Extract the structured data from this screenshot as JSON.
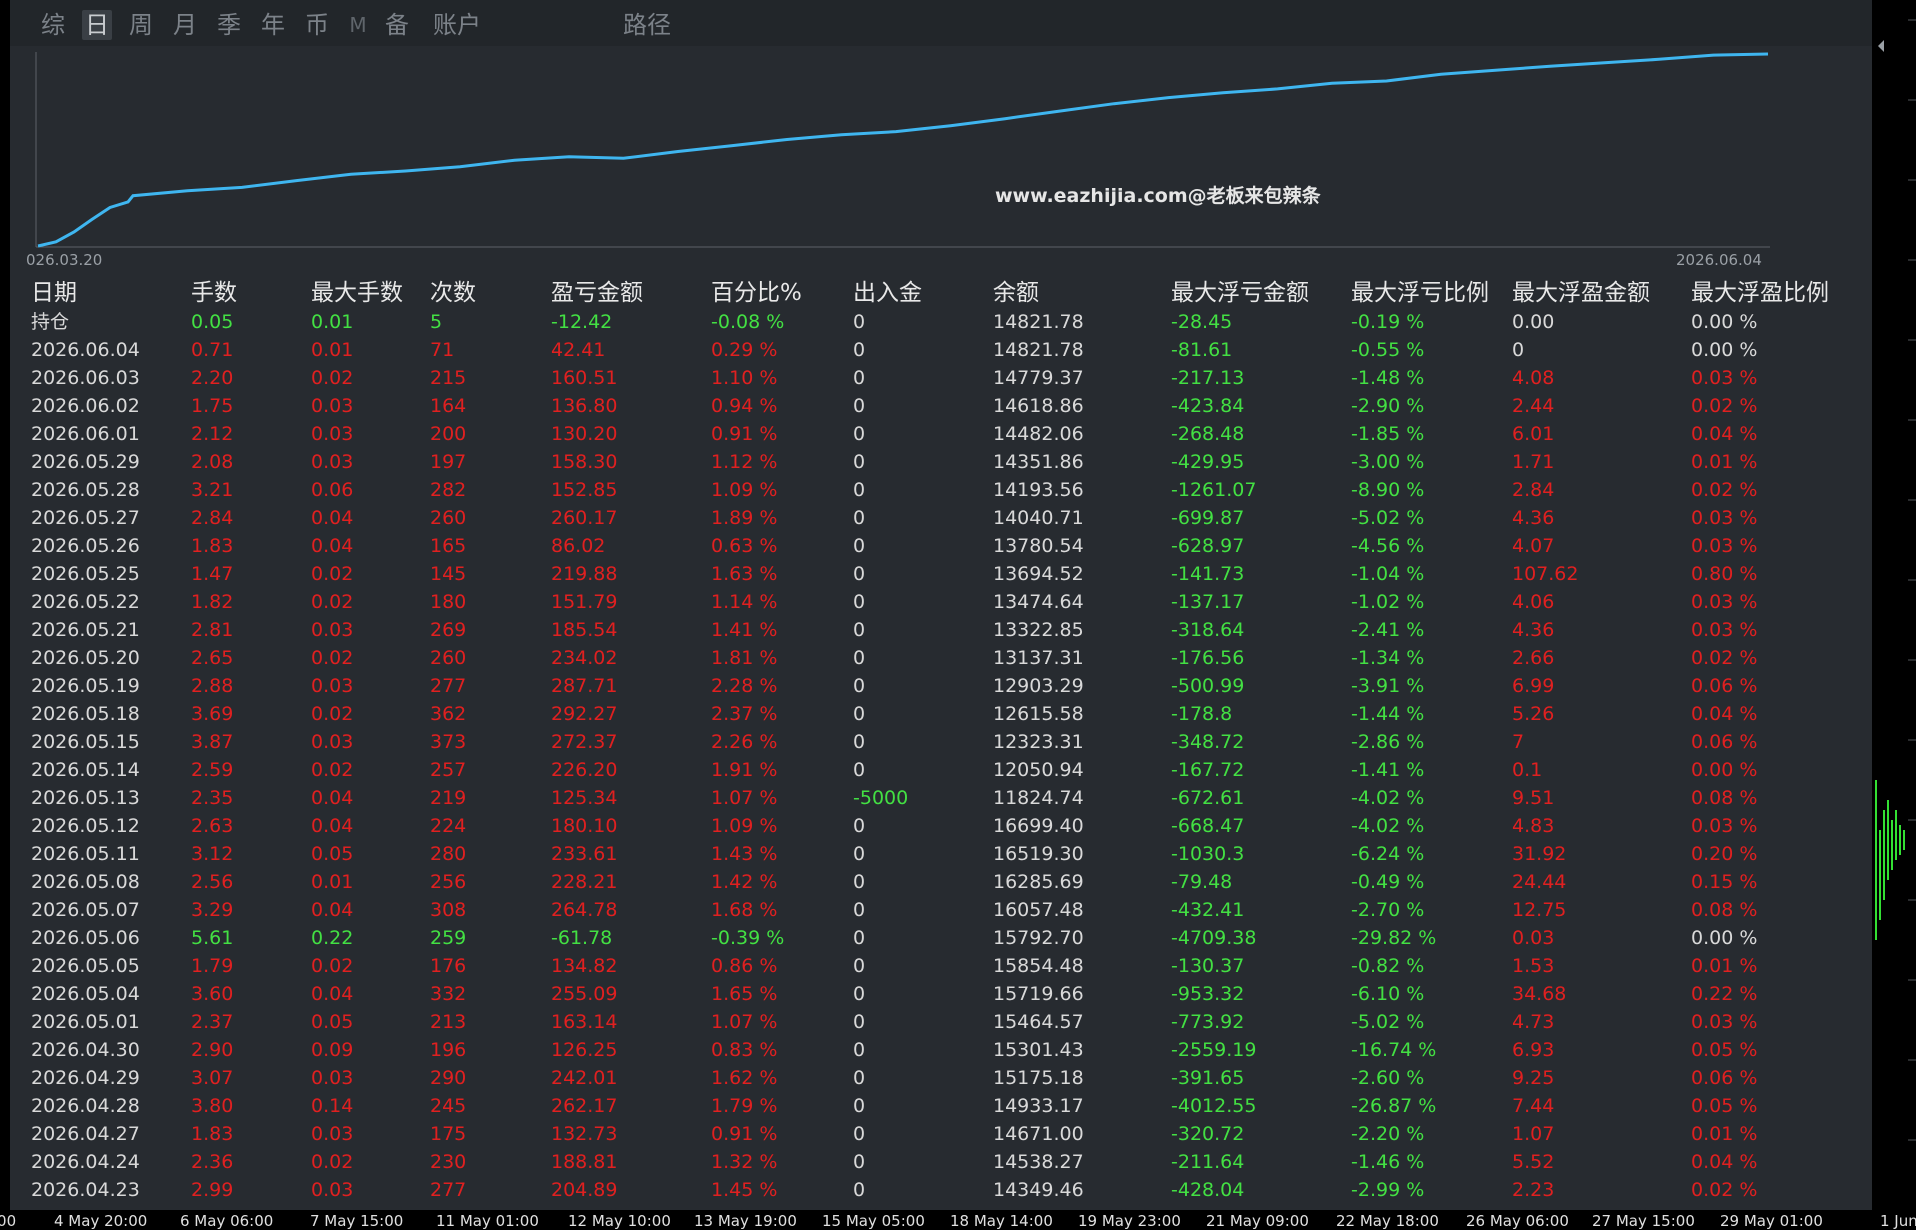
{
  "tabs": [
    {
      "label": "综",
      "active": false
    },
    {
      "label": "日",
      "active": true
    },
    {
      "label": "周",
      "active": false
    },
    {
      "label": "月",
      "active": false
    },
    {
      "label": "季",
      "active": false
    },
    {
      "label": "年",
      "active": false
    },
    {
      "label": "币",
      "active": false
    },
    {
      "label": "M",
      "active": false
    },
    {
      "label": "备",
      "active": false
    },
    {
      "label": "账户",
      "active": false
    },
    {
      "label": "路径",
      "active": false
    }
  ],
  "chart": {
    "watermark": "www.eazhijia.com@老板来包辣条",
    "start_date": "026.03.20",
    "end_date": "2026.06.04",
    "line_color": "#3fb6f0"
  },
  "columns": [
    "日期",
    "手数",
    "最大手数",
    "次数",
    "盈亏金额",
    "百分比%",
    "出入金",
    "余额",
    "最大浮亏金额",
    "最大浮亏比例",
    "最大浮盈金额",
    "最大浮盈比例"
  ],
  "rows": [
    {
      "date": "持仓",
      "lots": "0.05",
      "max_lots": "0.01",
      "count": "5",
      "pnl": "-12.42",
      "pct": "-0.08 %",
      "flow": "0",
      "balance": "14821.78",
      "max_dd": "-28.45",
      "max_dd_pct": "-0.19 %",
      "max_fp": "0.00",
      "max_fp_pct": "0.00 %",
      "color": "green",
      "fp_color": "white"
    },
    {
      "date": "2026.06.04",
      "lots": "0.71",
      "max_lots": "0.01",
      "count": "71",
      "pnl": "42.41",
      "pct": "0.29 %",
      "flow": "0",
      "balance": "14821.78",
      "max_dd": "-81.61",
      "max_dd_pct": "-0.55 %",
      "max_fp": "0",
      "max_fp_pct": "0.00 %",
      "color": "red",
      "fp_color": "white"
    },
    {
      "date": "2026.06.03",
      "lots": "2.20",
      "max_lots": "0.02",
      "count": "215",
      "pnl": "160.51",
      "pct": "1.10 %",
      "flow": "0",
      "balance": "14779.37",
      "max_dd": "-217.13",
      "max_dd_pct": "-1.48 %",
      "max_fp": "4.08",
      "max_fp_pct": "0.03 %",
      "color": "red",
      "fp_color": "red"
    },
    {
      "date": "2026.06.02",
      "lots": "1.75",
      "max_lots": "0.03",
      "count": "164",
      "pnl": "136.80",
      "pct": "0.94 %",
      "flow": "0",
      "balance": "14618.86",
      "max_dd": "-423.84",
      "max_dd_pct": "-2.90 %",
      "max_fp": "2.44",
      "max_fp_pct": "0.02 %",
      "color": "red",
      "fp_color": "red"
    },
    {
      "date": "2026.06.01",
      "lots": "2.12",
      "max_lots": "0.03",
      "count": "200",
      "pnl": "130.20",
      "pct": "0.91 %",
      "flow": "0",
      "balance": "14482.06",
      "max_dd": "-268.48",
      "max_dd_pct": "-1.85 %",
      "max_fp": "6.01",
      "max_fp_pct": "0.04 %",
      "color": "red",
      "fp_color": "red"
    },
    {
      "date": "2026.05.29",
      "lots": "2.08",
      "max_lots": "0.03",
      "count": "197",
      "pnl": "158.30",
      "pct": "1.12 %",
      "flow": "0",
      "balance": "14351.86",
      "max_dd": "-429.95",
      "max_dd_pct": "-3.00 %",
      "max_fp": "1.71",
      "max_fp_pct": "0.01 %",
      "color": "red",
      "fp_color": "red"
    },
    {
      "date": "2026.05.28",
      "lots": "3.21",
      "max_lots": "0.06",
      "count": "282",
      "pnl": "152.85",
      "pct": "1.09 %",
      "flow": "0",
      "balance": "14193.56",
      "max_dd": "-1261.07",
      "max_dd_pct": "-8.90 %",
      "max_fp": "2.84",
      "max_fp_pct": "0.02 %",
      "color": "red",
      "fp_color": "red"
    },
    {
      "date": "2026.05.27",
      "lots": "2.84",
      "max_lots": "0.04",
      "count": "260",
      "pnl": "260.17",
      "pct": "1.89 %",
      "flow": "0",
      "balance": "14040.71",
      "max_dd": "-699.87",
      "max_dd_pct": "-5.02 %",
      "max_fp": "4.36",
      "max_fp_pct": "0.03 %",
      "color": "red",
      "fp_color": "red"
    },
    {
      "date": "2026.05.26",
      "lots": "1.83",
      "max_lots": "0.04",
      "count": "165",
      "pnl": "86.02",
      "pct": "0.63 %",
      "flow": "0",
      "balance": "13780.54",
      "max_dd": "-628.97",
      "max_dd_pct": "-4.56 %",
      "max_fp": "4.07",
      "max_fp_pct": "0.03 %",
      "color": "red",
      "fp_color": "red"
    },
    {
      "date": "2026.05.25",
      "lots": "1.47",
      "max_lots": "0.02",
      "count": "145",
      "pnl": "219.88",
      "pct": "1.63 %",
      "flow": "0",
      "balance": "13694.52",
      "max_dd": "-141.73",
      "max_dd_pct": "-1.04 %",
      "max_fp": "107.62",
      "max_fp_pct": "0.80 %",
      "color": "red",
      "fp_color": "red"
    },
    {
      "date": "2026.05.22",
      "lots": "1.82",
      "max_lots": "0.02",
      "count": "180",
      "pnl": "151.79",
      "pct": "1.14 %",
      "flow": "0",
      "balance": "13474.64",
      "max_dd": "-137.17",
      "max_dd_pct": "-1.02 %",
      "max_fp": "4.06",
      "max_fp_pct": "0.03 %",
      "color": "red",
      "fp_color": "red"
    },
    {
      "date": "2026.05.21",
      "lots": "2.81",
      "max_lots": "0.03",
      "count": "269",
      "pnl": "185.54",
      "pct": "1.41 %",
      "flow": "0",
      "balance": "13322.85",
      "max_dd": "-318.64",
      "max_dd_pct": "-2.41 %",
      "max_fp": "4.36",
      "max_fp_pct": "0.03 %",
      "color": "red",
      "fp_color": "red"
    },
    {
      "date": "2026.05.20",
      "lots": "2.65",
      "max_lots": "0.02",
      "count": "260",
      "pnl": "234.02",
      "pct": "1.81 %",
      "flow": "0",
      "balance": "13137.31",
      "max_dd": "-176.56",
      "max_dd_pct": "-1.34 %",
      "max_fp": "2.66",
      "max_fp_pct": "0.02 %",
      "color": "red",
      "fp_color": "red"
    },
    {
      "date": "2026.05.19",
      "lots": "2.88",
      "max_lots": "0.03",
      "count": "277",
      "pnl": "287.71",
      "pct": "2.28 %",
      "flow": "0",
      "balance": "12903.29",
      "max_dd": "-500.99",
      "max_dd_pct": "-3.91 %",
      "max_fp": "6.99",
      "max_fp_pct": "0.06 %",
      "color": "red",
      "fp_color": "red"
    },
    {
      "date": "2026.05.18",
      "lots": "3.69",
      "max_lots": "0.02",
      "count": "362",
      "pnl": "292.27",
      "pct": "2.37 %",
      "flow": "0",
      "balance": "12615.58",
      "max_dd": "-178.8",
      "max_dd_pct": "-1.44 %",
      "max_fp": "5.26",
      "max_fp_pct": "0.04 %",
      "color": "red",
      "fp_color": "red"
    },
    {
      "date": "2026.05.15",
      "lots": "3.87",
      "max_lots": "0.03",
      "count": "373",
      "pnl": "272.37",
      "pct": "2.26 %",
      "flow": "0",
      "balance": "12323.31",
      "max_dd": "-348.72",
      "max_dd_pct": "-2.86 %",
      "max_fp": "7",
      "max_fp_pct": "0.06 %",
      "color": "red",
      "fp_color": "red"
    },
    {
      "date": "2026.05.14",
      "lots": "2.59",
      "max_lots": "0.02",
      "count": "257",
      "pnl": "226.20",
      "pct": "1.91 %",
      "flow": "0",
      "balance": "12050.94",
      "max_dd": "-167.72",
      "max_dd_pct": "-1.41 %",
      "max_fp": "0.1",
      "max_fp_pct": "0.00 %",
      "color": "red",
      "fp_color": "red"
    },
    {
      "date": "2026.05.13",
      "lots": "2.35",
      "max_lots": "0.04",
      "count": "219",
      "pnl": "125.34",
      "pct": "1.07 %",
      "flow": "-5000",
      "balance": "11824.74",
      "max_dd": "-672.61",
      "max_dd_pct": "-4.02 %",
      "max_fp": "9.51",
      "max_fp_pct": "0.08 %",
      "color": "red",
      "fp_color": "red",
      "flow_green": true
    },
    {
      "date": "2026.05.12",
      "lots": "2.63",
      "max_lots": "0.04",
      "count": "224",
      "pnl": "180.10",
      "pct": "1.09 %",
      "flow": "0",
      "balance": "16699.40",
      "max_dd": "-668.47",
      "max_dd_pct": "-4.02 %",
      "max_fp": "4.83",
      "max_fp_pct": "0.03 %",
      "color": "red",
      "fp_color": "red"
    },
    {
      "date": "2026.05.11",
      "lots": "3.12",
      "max_lots": "0.05",
      "count": "280",
      "pnl": "233.61",
      "pct": "1.43 %",
      "flow": "0",
      "balance": "16519.30",
      "max_dd": "-1030.3",
      "max_dd_pct": "-6.24 %",
      "max_fp": "31.92",
      "max_fp_pct": "0.20 %",
      "color": "red",
      "fp_color": "red"
    },
    {
      "date": "2026.05.08",
      "lots": "2.56",
      "max_lots": "0.01",
      "count": "256",
      "pnl": "228.21",
      "pct": "1.42 %",
      "flow": "0",
      "balance": "16285.69",
      "max_dd": "-79.48",
      "max_dd_pct": "-0.49 %",
      "max_fp": "24.44",
      "max_fp_pct": "0.15 %",
      "color": "red",
      "fp_color": "red"
    },
    {
      "date": "2026.05.07",
      "lots": "3.29",
      "max_lots": "0.04",
      "count": "308",
      "pnl": "264.78",
      "pct": "1.68 %",
      "flow": "0",
      "balance": "16057.48",
      "max_dd": "-432.41",
      "max_dd_pct": "-2.70 %",
      "max_fp": "12.75",
      "max_fp_pct": "0.08 %",
      "color": "red",
      "fp_color": "red"
    },
    {
      "date": "2026.05.06",
      "lots": "5.61",
      "max_lots": "0.22",
      "count": "259",
      "pnl": "-61.78",
      "pct": "-0.39 %",
      "flow": "0",
      "balance": "15792.70",
      "max_dd": "-4709.38",
      "max_dd_pct": "-29.82 %",
      "max_fp": "0.03",
      "max_fp_pct": "0.00 %",
      "color": "green",
      "fp_color": "red",
      "fp_pct_white": true
    },
    {
      "date": "2026.05.05",
      "lots": "1.79",
      "max_lots": "0.02",
      "count": "176",
      "pnl": "134.82",
      "pct": "0.86 %",
      "flow": "0",
      "balance": "15854.48",
      "max_dd": "-130.37",
      "max_dd_pct": "-0.82 %",
      "max_fp": "1.53",
      "max_fp_pct": "0.01 %",
      "color": "red",
      "fp_color": "red"
    },
    {
      "date": "2026.05.04",
      "lots": "3.60",
      "max_lots": "0.04",
      "count": "332",
      "pnl": "255.09",
      "pct": "1.65 %",
      "flow": "0",
      "balance": "15719.66",
      "max_dd": "-953.32",
      "max_dd_pct": "-6.10 %",
      "max_fp": "34.68",
      "max_fp_pct": "0.22 %",
      "color": "red",
      "fp_color": "red"
    },
    {
      "date": "2026.05.01",
      "lots": "2.37",
      "max_lots": "0.05",
      "count": "213",
      "pnl": "163.14",
      "pct": "1.07 %",
      "flow": "0",
      "balance": "15464.57",
      "max_dd": "-773.92",
      "max_dd_pct": "-5.02 %",
      "max_fp": "4.73",
      "max_fp_pct": "0.03 %",
      "color": "red",
      "fp_color": "red"
    },
    {
      "date": "2026.04.30",
      "lots": "2.90",
      "max_lots": "0.09",
      "count": "196",
      "pnl": "126.25",
      "pct": "0.83 %",
      "flow": "0",
      "balance": "15301.43",
      "max_dd": "-2559.19",
      "max_dd_pct": "-16.74 %",
      "max_fp": "6.93",
      "max_fp_pct": "0.05 %",
      "color": "red",
      "fp_color": "red"
    },
    {
      "date": "2026.04.29",
      "lots": "3.07",
      "max_lots": "0.03",
      "count": "290",
      "pnl": "242.01",
      "pct": "1.62 %",
      "flow": "0",
      "balance": "15175.18",
      "max_dd": "-391.65",
      "max_dd_pct": "-2.60 %",
      "max_fp": "9.25",
      "max_fp_pct": "0.06 %",
      "color": "red",
      "fp_color": "red"
    },
    {
      "date": "2026.04.28",
      "lots": "3.80",
      "max_lots": "0.14",
      "count": "245",
      "pnl": "262.17",
      "pct": "1.79 %",
      "flow": "0",
      "balance": "14933.17",
      "max_dd": "-4012.55",
      "max_dd_pct": "-26.87 %",
      "max_fp": "7.44",
      "max_fp_pct": "0.05 %",
      "color": "red",
      "fp_color": "red"
    },
    {
      "date": "2026.04.27",
      "lots": "1.83",
      "max_lots": "0.03",
      "count": "175",
      "pnl": "132.73",
      "pct": "0.91 %",
      "flow": "0",
      "balance": "14671.00",
      "max_dd": "-320.72",
      "max_dd_pct": "-2.20 %",
      "max_fp": "1.07",
      "max_fp_pct": "0.01 %",
      "color": "red",
      "fp_color": "red"
    },
    {
      "date": "2026.04.24",
      "lots": "2.36",
      "max_lots": "0.02",
      "count": "230",
      "pnl": "188.81",
      "pct": "1.32 %",
      "flow": "0",
      "balance": "14538.27",
      "max_dd": "-211.64",
      "max_dd_pct": "-1.46 %",
      "max_fp": "5.52",
      "max_fp_pct": "0.04 %",
      "color": "red",
      "fp_color": "red"
    },
    {
      "date": "2026.04.23",
      "lots": "2.99",
      "max_lots": "0.03",
      "count": "277",
      "pnl": "204.89",
      "pct": "1.45 %",
      "flow": "0",
      "balance": "14349.46",
      "max_dd": "-428.04",
      "max_dd_pct": "-2.99 %",
      "max_fp": "2.23",
      "max_fp_pct": "0.02 %",
      "color": "red",
      "fp_color": "red"
    }
  ],
  "time_axis": [
    ":00",
    "4 May 20:00",
    "6 May 06:00",
    "7 May 15:00",
    "11 May 01:00",
    "12 May 10:00",
    "13 May 19:00",
    "15 May 05:00",
    "18 May 14:00",
    "19 May 23:00",
    "21 May 09:00",
    "22 May 18:00",
    "26 May 06:00",
    "27 May 15:00",
    "29 May 01:00",
    "1 Jun"
  ]
}
